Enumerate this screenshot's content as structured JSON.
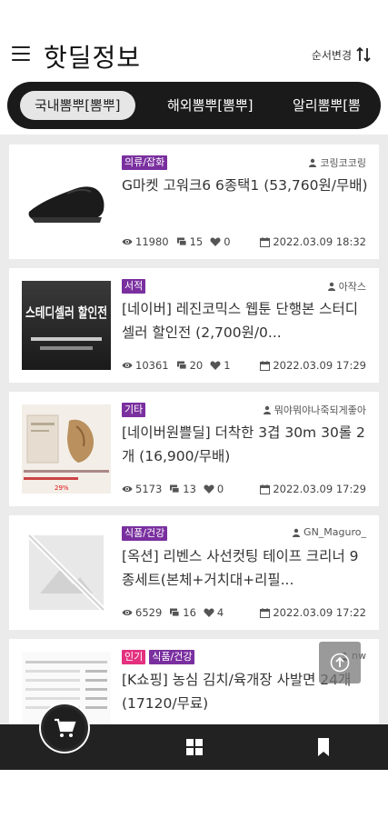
{
  "header": {
    "title": "핫딜정보",
    "sort_label": "순서변경",
    "menu_icon": "hamburger-icon",
    "sort_icon": "sort-arrows-icon"
  },
  "categories": [
    {
      "label": "국내뽐뿌[뽐뿌]",
      "active": true
    },
    {
      "label": "해외뽐뿌[뽐뿌]",
      "active": false
    },
    {
      "label": "알리뽐뿌[뽐",
      "active": false
    }
  ],
  "posts": [
    {
      "badges": [
        "의류/잡화"
      ],
      "author": "코링코코링",
      "title": "G마켓 고워크6 6종택1 (53,760원/무배)",
      "views": "11980",
      "comments": "15",
      "likes": "0",
      "date": "2022.03.09 18:32",
      "thumb": "shoe"
    },
    {
      "badges": [
        "서적"
      ],
      "author": "아작스",
      "title": "[네이버] 레진코믹스 웹툰 단행본 스터디셀러 할인전 (2,700원/0...",
      "views": "10361",
      "comments": "20",
      "likes": "1",
      "date": "2022.03.09 17:29",
      "thumb": "banner",
      "thumb_text": "스테디셀러 할인전"
    },
    {
      "badges": [
        "기타"
      ],
      "author": "뭐야뭐야나죽되게좋아",
      "title": "[네이버원쁠딜] 더착한 3겹 30m 30롤 2개 (16,900/무배)",
      "views": "5173",
      "comments": "13",
      "likes": "0",
      "date": "2022.03.09 17:29",
      "thumb": "product",
      "thumb_price": "29%"
    },
    {
      "badges": [
        "식품/건강"
      ],
      "author": "GN_Maguro_",
      "title": "[옥션] 리벤스 사선컷팅 테이프 크리너 9종세트(본체+거치대+리필...",
      "views": "6529",
      "comments": "16",
      "likes": "4",
      "date": "2022.03.09 17:22",
      "thumb": "placeholder"
    },
    {
      "badges": [
        "인기",
        "식품/건강"
      ],
      "author": "nw",
      "title": "[K쇼핑] 농심 김치/육개장 사발면 24개 (17120/무료)",
      "views": "",
      "comments": "",
      "likes": "",
      "date": "",
      "thumb": "list"
    }
  ],
  "colors": {
    "badge": "#7a2f9f",
    "badge_hot": "#e3307f",
    "bar": "#1a1a1a",
    "nav": "#222222"
  },
  "nav": {
    "cart_icon": "cart-icon",
    "grid_icon": "grid-icon",
    "bookmark_icon": "bookmark-icon",
    "up_icon": "scroll-top-icon"
  }
}
